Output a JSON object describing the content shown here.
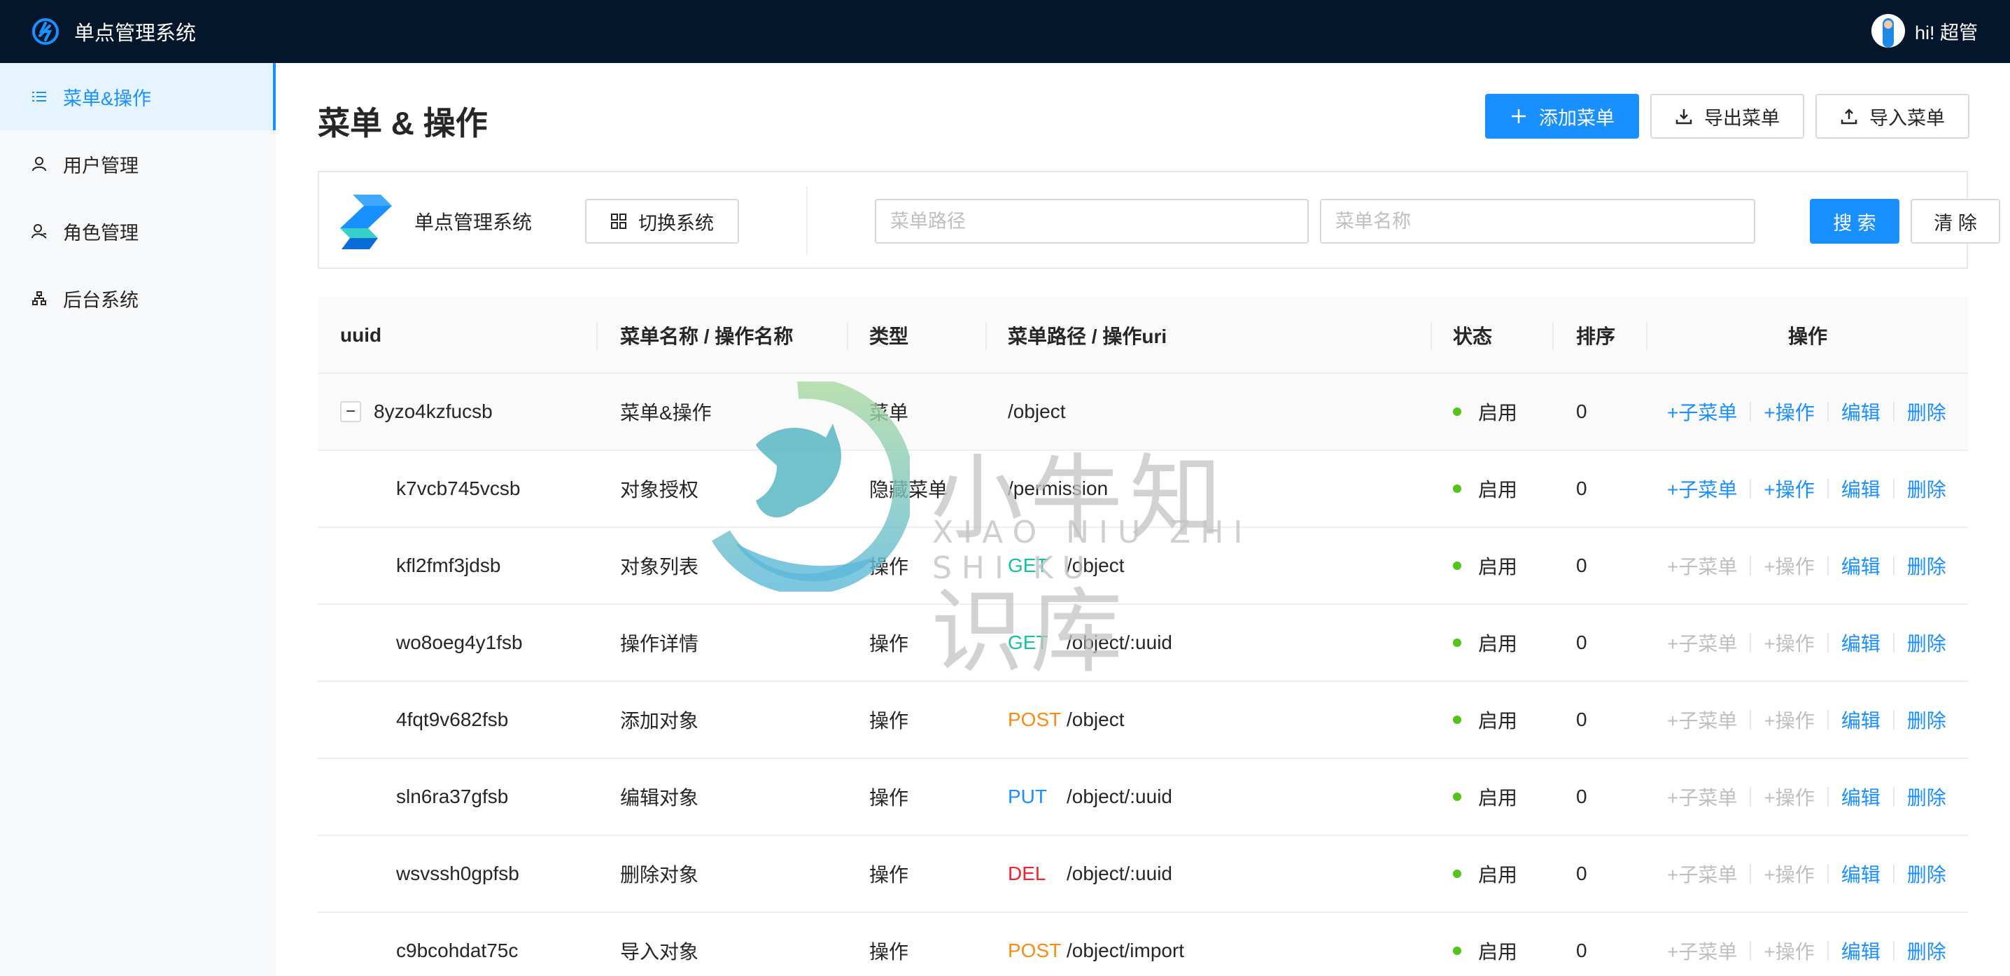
{
  "header": {
    "title": "单点管理系统",
    "user": "hi! 超管"
  },
  "sidebar": {
    "items": [
      {
        "label": "菜单&操作",
        "icon": "list-icon",
        "active": true
      },
      {
        "label": "用户管理",
        "icon": "user-icon",
        "active": false
      },
      {
        "label": "角色管理",
        "icon": "role-icon",
        "active": false
      },
      {
        "label": "后台系统",
        "icon": "cluster-icon",
        "active": false
      }
    ]
  },
  "page": {
    "title": "菜单 & 操作",
    "add_button": "添加菜单",
    "export_button": "导出菜单",
    "import_button": "导入菜单"
  },
  "filter": {
    "system_name": "单点管理系统",
    "switch_button": "切换系统",
    "path_placeholder": "菜单路径",
    "name_placeholder": "菜单名称",
    "search_button": "搜 索",
    "clear_button": "清 除"
  },
  "table": {
    "columns": [
      "uuid",
      "菜单名称 / 操作名称",
      "类型",
      "菜单路径 / 操作uri",
      "状态",
      "排序",
      "操作"
    ],
    "rows": [
      {
        "uuid": "8yzo4kzfucsb",
        "name": "菜单&操作",
        "type": "菜单",
        "method": "",
        "path": "/object",
        "status": "启用",
        "sort": "0",
        "expandable": true
      },
      {
        "uuid": "k7vcb745vcsb",
        "name": "对象授权",
        "type": "隐藏菜单",
        "method": "",
        "path": "/permission",
        "status": "启用",
        "sort": "0"
      },
      {
        "uuid": "kfl2fmf3jdsb",
        "name": "对象列表",
        "type": "操作",
        "method": "GET",
        "path": "/object",
        "status": "启用",
        "sort": "0"
      },
      {
        "uuid": "wo8oeg4y1fsb",
        "name": "操作详情",
        "type": "操作",
        "method": "GET",
        "path": "/object/:uuid",
        "status": "启用",
        "sort": "0"
      },
      {
        "uuid": "4fqt9v682fsb",
        "name": "添加对象",
        "type": "操作",
        "method": "POST",
        "path": "/object",
        "status": "启用",
        "sort": "0"
      },
      {
        "uuid": "sln6ra37gfsb",
        "name": "编辑对象",
        "type": "操作",
        "method": "PUT",
        "path": "/object/:uuid",
        "status": "启用",
        "sort": "0"
      },
      {
        "uuid": "wsvssh0gpfsb",
        "name": "删除对象",
        "type": "操作",
        "method": "DEL",
        "path": "/object/:uuid",
        "status": "启用",
        "sort": "0"
      },
      {
        "uuid": "c9bcohdat75c",
        "name": "导入对象",
        "type": "操作",
        "method": "POST",
        "path": "/object/import",
        "status": "启用",
        "sort": "0"
      }
    ],
    "actions": {
      "add_child": "+子菜单",
      "add_op": "+操作",
      "edit": "编辑",
      "delete": "删除"
    }
  },
  "method_colors": {
    "GET": "#13c2a0",
    "POST": "#fa8c16",
    "PUT": "#1890ff",
    "DEL": "#f5222d"
  },
  "colors": {
    "primary": "#1890ff",
    "topbar": "#04162b",
    "enabled_dot": "#52c41a"
  },
  "watermark": {
    "cn": "小牛知识库",
    "en": "XIAO NIU ZHI SHI KU"
  }
}
